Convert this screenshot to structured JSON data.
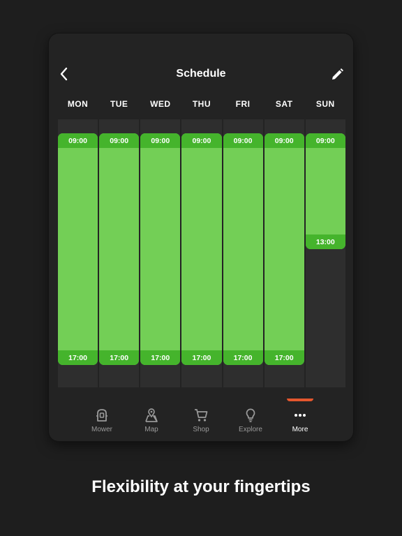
{
  "header": {
    "title": "Schedule"
  },
  "schedule": {
    "days": [
      {
        "label": "MON",
        "start": "09:00",
        "end": "17:00"
      },
      {
        "label": "TUE",
        "start": "09:00",
        "end": "17:00"
      },
      {
        "label": "WED",
        "start": "09:00",
        "end": "17:00"
      },
      {
        "label": "THU",
        "start": "09:00",
        "end": "17:00"
      },
      {
        "label": "FRI",
        "start": "09:00",
        "end": "17:00"
      },
      {
        "label": "SAT",
        "start": "09:00",
        "end": "17:00"
      },
      {
        "label": "SUN",
        "start": "09:00",
        "end": "13:00"
      }
    ]
  },
  "tabs": [
    {
      "label": "Mower",
      "icon": "mower-icon"
    },
    {
      "label": "Map",
      "icon": "map-pin-icon"
    },
    {
      "label": "Shop",
      "icon": "cart-icon"
    },
    {
      "label": "Explore",
      "icon": "lightbulb-icon"
    },
    {
      "label": "More",
      "icon": "more-dots-icon",
      "active": true
    }
  ],
  "caption": "Flexibility at your fingertips",
  "colors": {
    "background": "#1e1e1e",
    "panel": "#232323",
    "slot": "#73cf56",
    "slot_time": "#45b42c",
    "active_tab": "#e4572e"
  }
}
